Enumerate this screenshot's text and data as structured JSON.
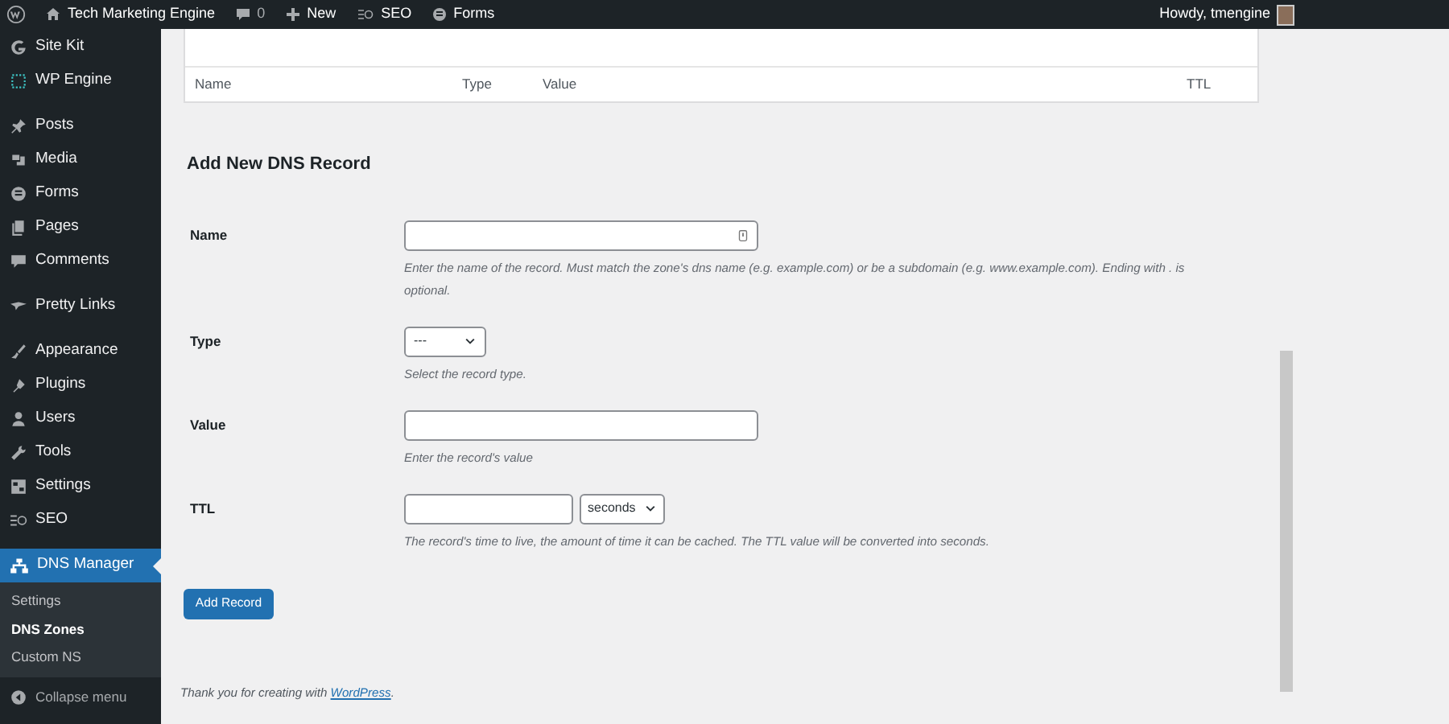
{
  "admin_bar": {
    "site": "Tech Marketing Engine",
    "comments": "0",
    "new": "New",
    "items": [
      "SEO",
      "Forms"
    ],
    "greeting": "Howdy, tmengine"
  },
  "sidebar": {
    "groups": [
      [
        {
          "label": "Site Kit",
          "selected": false
        },
        {
          "label": "WP Engine",
          "selected": false
        }
      ],
      [
        {
          "label": "Posts",
          "selected": false
        },
        {
          "label": "Media",
          "selected": false
        },
        {
          "label": "Forms",
          "selected": false
        },
        {
          "label": "Pages",
          "selected": false
        },
        {
          "label": "Comments",
          "selected": false
        }
      ],
      [
        {
          "label": "Pretty Links",
          "selected": false
        }
      ],
      [
        {
          "label": "Appearance",
          "selected": false
        },
        {
          "label": "Plugins",
          "selected": false
        },
        {
          "label": "Users",
          "selected": false
        },
        {
          "label": "Tools",
          "selected": false
        },
        {
          "label": "Settings",
          "selected": false
        },
        {
          "label": "SEO",
          "selected": false
        }
      ],
      [
        {
          "label": "DNS Manager",
          "selected": true,
          "children": [
            {
              "label": "Settings",
              "selected": false
            },
            {
              "label": "DNS Zones",
              "selected": true
            },
            {
              "label": "Custom NS",
              "selected": false
            }
          ]
        }
      ]
    ],
    "collapse": "Collapse menu"
  },
  "table": {
    "columns": [
      "Name",
      "Type",
      "Value",
      "TTL"
    ]
  },
  "form": {
    "title": "Add New DNS Record",
    "fields": [
      {
        "kind": "text",
        "label": "Name",
        "help": "Enter the name of the record. Must match the zone's dns name (e.g. example.com) or be a subdomain (e.g. www.example.com). Ending with . is optional."
      },
      {
        "kind": "select",
        "label": "Type",
        "value": "---",
        "help": "Select the record type."
      },
      {
        "kind": "text",
        "label": "Value",
        "help": "Enter the record's value"
      },
      {
        "kind": "ttl",
        "label": "TTL",
        "unit": "seconds",
        "help": "The record's time to live, the amount of time it can be cached. The TTL value will be converted into seconds."
      }
    ],
    "submit": "Add Record"
  },
  "footer": {
    "text": "Thank you for creating with ",
    "link": "WordPress",
    "after": "."
  }
}
